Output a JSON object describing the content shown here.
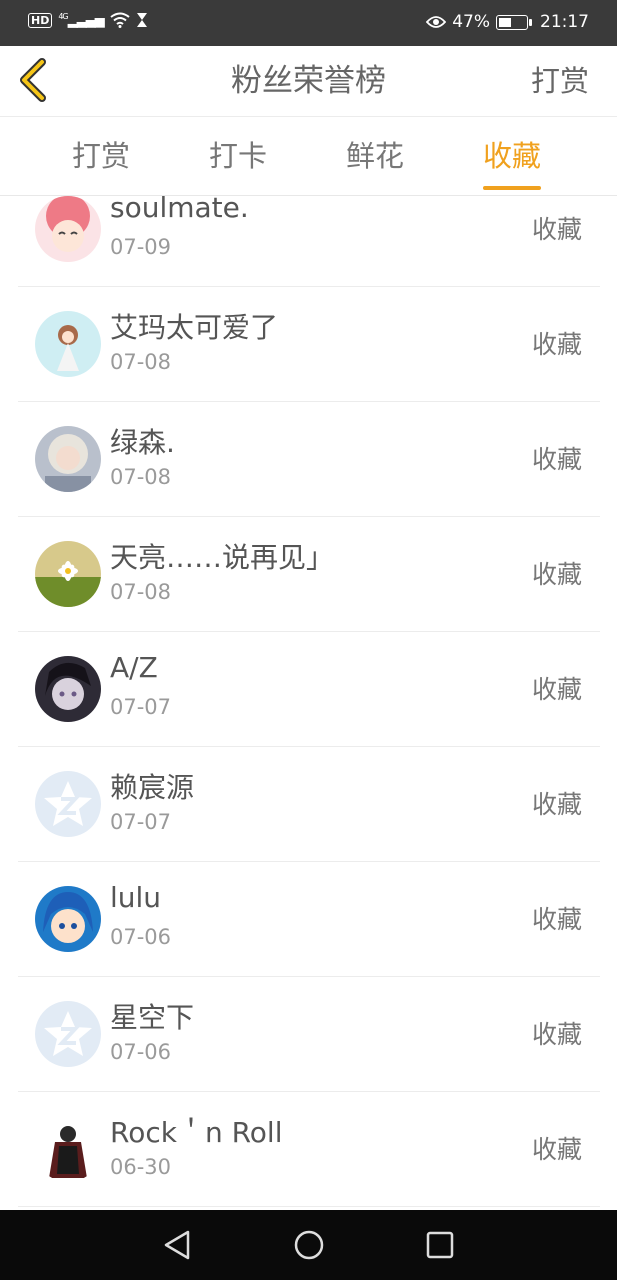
{
  "status_bar": {
    "network": "4G",
    "battery_percent": "47%",
    "time": "21:17",
    "icons": [
      "hd-icon",
      "signal-icon",
      "wifi-icon",
      "hourglass-icon",
      "eye-icon",
      "battery-icon"
    ]
  },
  "header": {
    "title": "粉丝荣誉榜",
    "right_action": "打赏",
    "back_icon": "chevron-left-icon",
    "accent_color": "#f0a11e"
  },
  "tabs": [
    {
      "label": "打赏",
      "active": false
    },
    {
      "label": "打卡",
      "active": false
    },
    {
      "label": "鲜花",
      "active": false
    },
    {
      "label": "收藏",
      "active": true
    }
  ],
  "fans": [
    {
      "name": "soulmate.",
      "date": "07-09",
      "action": "收藏",
      "avatar": "pink-hair-anime-avatar"
    },
    {
      "name": "艾玛太可爱了",
      "date": "07-08",
      "action": "收藏",
      "avatar": "doll-avatar"
    },
    {
      "name": "绿森.",
      "date": "07-08",
      "action": "收藏",
      "avatar": "blonde-girl-avatar"
    },
    {
      "name": "天亮……说再见」",
      "date": "07-08",
      "action": "收藏",
      "avatar": "daisy-avatar"
    },
    {
      "name": "A/Z",
      "date": "07-07",
      "action": "收藏",
      "avatar": "dark-hair-anime-avatar"
    },
    {
      "name": "赖宸源",
      "date": "07-07",
      "action": "收藏",
      "avatar": "default-star-avatar"
    },
    {
      "name": "lulu",
      "date": "07-06",
      "action": "收藏",
      "avatar": "blue-hair-anime-avatar"
    },
    {
      "name": "星空下",
      "date": "07-06",
      "action": "收藏",
      "avatar": "default-star-avatar"
    },
    {
      "name": "Rock＇n Roll",
      "date": "06-30",
      "action": "收藏",
      "avatar": "dark-figure-avatar"
    }
  ],
  "nav_bar": {
    "icons": [
      "back-triangle-icon",
      "home-circle-icon",
      "recents-square-icon"
    ]
  }
}
